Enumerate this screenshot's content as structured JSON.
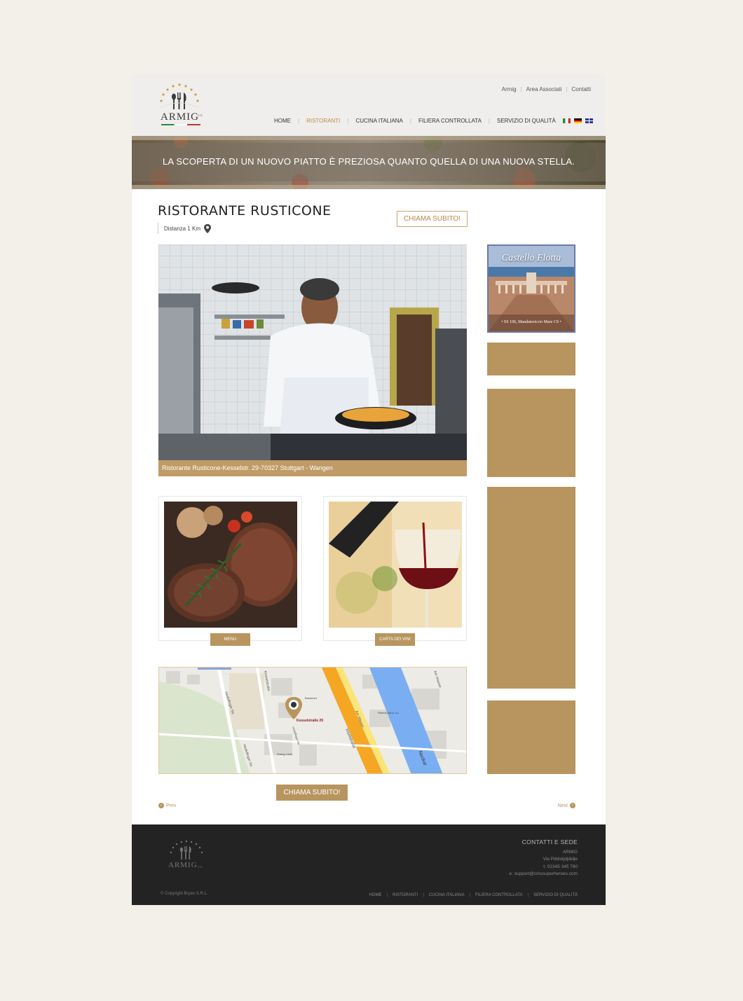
{
  "brand": {
    "name": "ARMIG",
    "superscript": "S.R."
  },
  "top_links": [
    "Armig",
    "Area Associati",
    "Contatti"
  ],
  "nav": {
    "items": [
      "HOME",
      "RISTORANTI",
      "CUCINA ITALIANA",
      "FILIERA CONTROLLATA",
      "SERVIZIO DI QUALITÀ"
    ],
    "active": "RISTORANTI"
  },
  "languages": [
    "it",
    "de",
    "en"
  ],
  "banner": {
    "text": "LA SCOPERTA DI UN NUOVO PIATTO È PREZIOSA QUANTO QUELLA DI UNA NUOVA STELLA."
  },
  "restaurant": {
    "title": "RISTORANTE RUSTICONE",
    "distance": "Distanza 1 Km",
    "call_label": "CHIAMA SUBITO!",
    "photo_caption": "Ristorante Rusticone-Kesselstr. 29-70327 Stuttgart - Wangen"
  },
  "cards": [
    {
      "button": "MENU",
      "image": "grilled-steak"
    },
    {
      "button": "CARTA DEI VINI",
      "image": "red-wine-glass"
    }
  ],
  "map": {
    "marker_label": "Kesselstraße 29",
    "street_labels": [
      "Kesselstraße",
      "Hedelfinger Str.",
      "Hedelfinger Str.",
      "Inselstraße",
      "Am Wasser",
      "Am Wasser",
      "Neckar",
      "Rheinlu Art & Co.",
      "Shang Lüchi",
      "Brackmer",
      "Hedelfinger Str."
    ]
  },
  "bottom_call_label": "CHIAMA SUBITO!",
  "pager": {
    "prev": "Prev",
    "next": "Next"
  },
  "sidebar": {
    "ad": {
      "title": "Castello Flotta",
      "subtitle": "• SS 106, Mandatoriccio Mare CS •"
    }
  },
  "footer": {
    "contact_heading": "CONTATTI E SEDE",
    "contact_lines": [
      "ARMIG",
      "Via Pddskjdjdidje",
      "t: 02345 345 780",
      "e: support@cmssuperheroes.com"
    ],
    "copyright": "© Copyright Bryan S.R.L.",
    "nav": [
      "HOME",
      "RISTORANTI",
      "CUCINA ITALIANA",
      "FILIERA CONTROLLATA",
      "SERVIZIO DI QUALITÀ"
    ]
  },
  "colors": {
    "accent": "#b8955e",
    "accent_text": "#c08a4a",
    "footer_bg": "#232323",
    "page_bg": "#f3efe9"
  }
}
